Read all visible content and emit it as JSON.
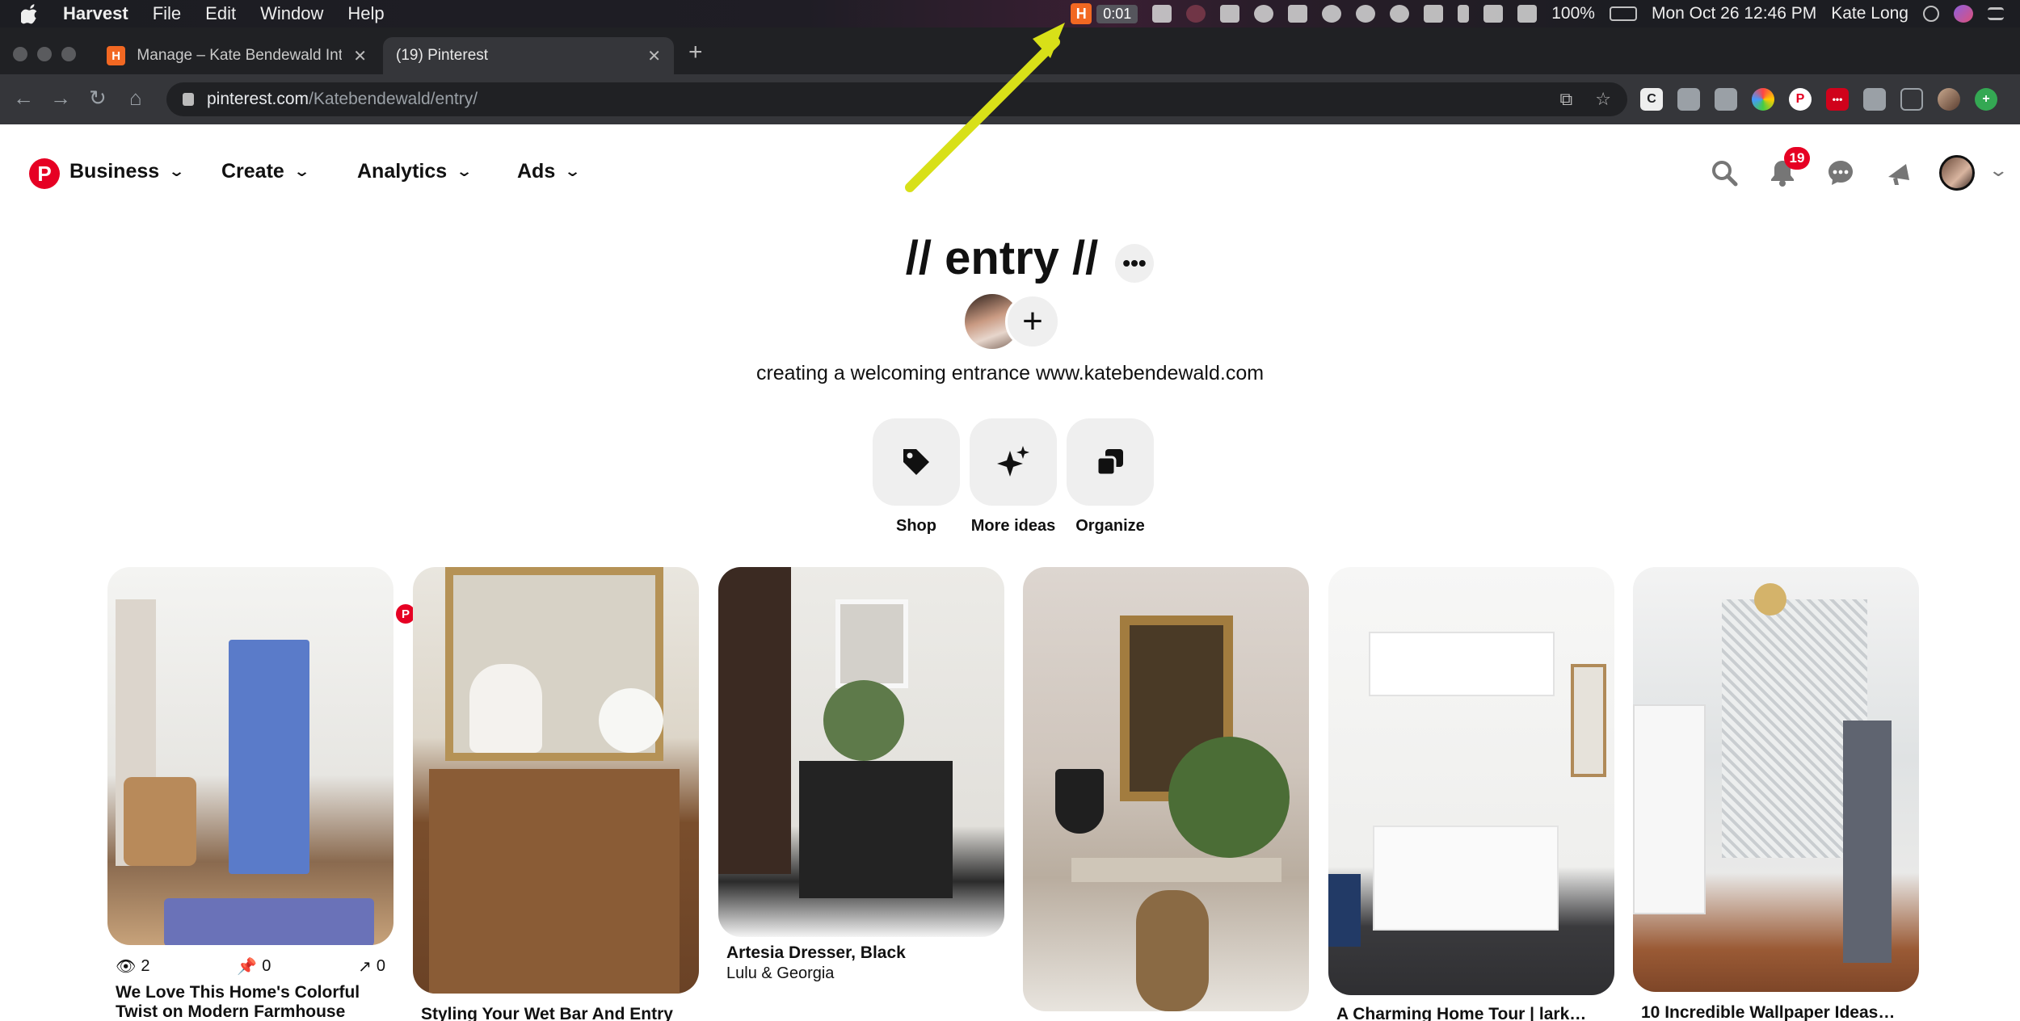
{
  "menubar": {
    "app_name": "Harvest",
    "menus": [
      "File",
      "Edit",
      "Window",
      "Help"
    ],
    "harvest_icon": "H",
    "timer": "0:01",
    "battery": "100%",
    "datetime": "Mon Oct 26  12:46 PM",
    "user": "Kate Long"
  },
  "browser": {
    "tabs": [
      {
        "label": "Manage – Kate Bendewald Inte",
        "favicon": "H"
      },
      {
        "label": "(19) Pinterest",
        "favicon": "P"
      }
    ],
    "url_host": "pinterest.com",
    "url_path": "/Katebendewald/entry/",
    "extensions": [
      "C",
      "",
      "",
      "",
      "P",
      "•••",
      "",
      "",
      "",
      "+"
    ]
  },
  "pinterest": {
    "nav": {
      "logo": "P",
      "business": "Business",
      "create": "Create",
      "analytics": "Analytics",
      "ads": "Ads",
      "notification_count": "19"
    },
    "board": {
      "title": "// entry //",
      "more": "•••",
      "add": "+",
      "description": "creating a welcoming entrance www.katebendewald.com"
    },
    "actions": [
      {
        "label": "Shop",
        "icon": "tag-icon"
      },
      {
        "label": "More ideas",
        "icon": "sparkle-icon"
      },
      {
        "label": "Organize",
        "icon": "organize-icon"
      }
    ],
    "pins": [
      {
        "title": "We Love This Home's Colorful Twist on Modern Farmhouse",
        "views": "2",
        "saves": "0",
        "clicks": "0"
      },
      {
        "title": "Styling Your Wet Bar And Entry"
      },
      {
        "title": "Artesia Dresser, Black",
        "subtitle": "Lulu & Georgia"
      },
      {
        "title": ""
      },
      {
        "title": "A Charming Home Tour | lark…"
      },
      {
        "title": "10 Incredible Wallpaper Ideas…"
      }
    ]
  },
  "colors": {
    "pinterest_red": "#e60023",
    "harvest_orange": "#f26822",
    "annotation_arrow": "#e8f020"
  }
}
